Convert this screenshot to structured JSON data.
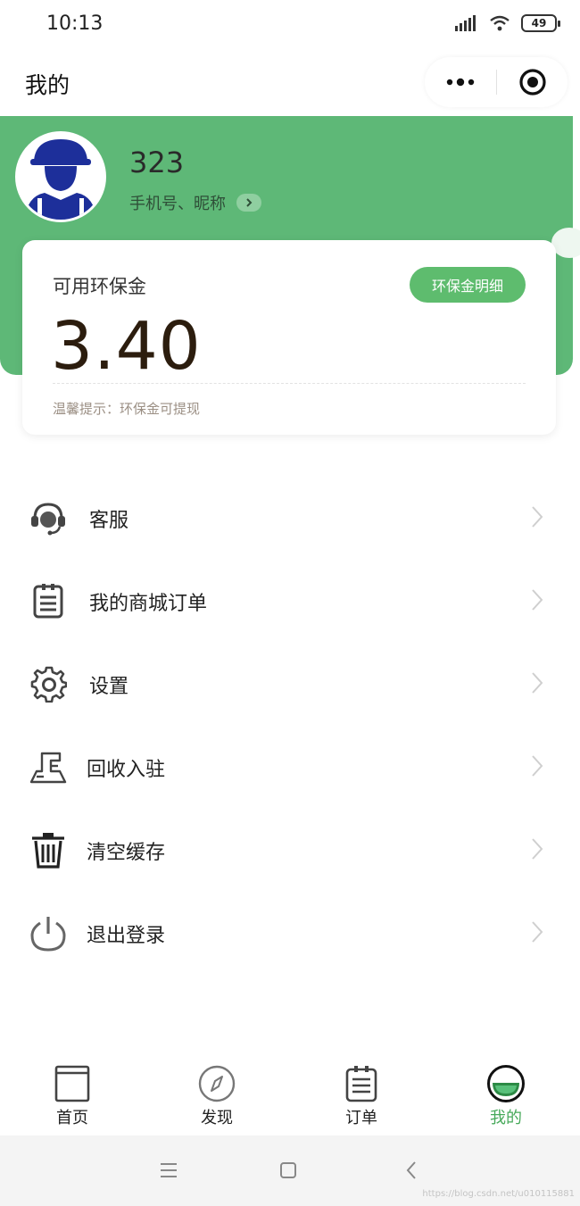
{
  "status_bar": {
    "time": "10:13",
    "battery": "49"
  },
  "header": {
    "title": "我的"
  },
  "user": {
    "name": "323",
    "sub_label": "手机号、昵称"
  },
  "balance_card": {
    "label": "可用环保金",
    "detail_button": "环保金明细",
    "amount": "3.40",
    "tip": "温馨提示：环保金可提现"
  },
  "menu": [
    {
      "label": "客服",
      "icon": "headset-icon"
    },
    {
      "label": "我的商城订单",
      "icon": "clipboard-icon"
    },
    {
      "label": "设置",
      "icon": "gear-icon"
    },
    {
      "label": "回收入驻",
      "icon": "station-icon"
    },
    {
      "label": "清空缓存",
      "icon": "trash-icon"
    },
    {
      "label": "退出登录",
      "icon": "power-icon"
    }
  ],
  "tabbar": [
    {
      "label": "首页",
      "icon": "home-tab-icon",
      "active": false
    },
    {
      "label": "发现",
      "icon": "compass-icon",
      "active": false
    },
    {
      "label": "订单",
      "icon": "order-tab-icon",
      "active": false
    },
    {
      "label": "我的",
      "icon": "profile-tab-icon",
      "active": true
    }
  ],
  "colors": {
    "brand_green": "#5eb877",
    "active_tab": "#47a95a",
    "amount_text": "#2c1d0e"
  },
  "watermark": "https://blog.csdn.net/u010115881"
}
